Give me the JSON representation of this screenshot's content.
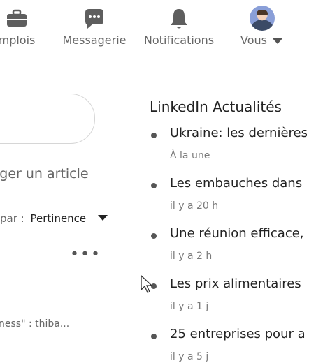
{
  "nav": {
    "jobs_label": "mplois",
    "messaging_label": "Messagerie",
    "notifications_label": "Notifications",
    "me_label": "Vous",
    "icons": {
      "jobs": "briefcase-icon",
      "messaging": "chat-bubble-icon",
      "notifications": "bell-icon",
      "me": "avatar"
    }
  },
  "left": {
    "write_article": "iger un article",
    "sort_prefix": "par :",
    "sort_value": "Pertinence",
    "more_label": "•••",
    "snippet": "ness\" : thiba..."
  },
  "news": {
    "title": "LinkedIn Actualités",
    "items": [
      {
        "headline": "Ukraine: les dernières",
        "meta": "À la une"
      },
      {
        "headline": "Les embauches dans",
        "meta": "il y a 20 h"
      },
      {
        "headline": "Une réunion efficace,",
        "meta": "il y a 2 h"
      },
      {
        "headline": "Les prix alimentaires",
        "meta": "il y a 1 j"
      },
      {
        "headline": "25 entreprises pour a",
        "meta": "il y a 5 j"
      }
    ]
  },
  "colors": {
    "icon": "#5e5e5e",
    "text_secondary": "#666666",
    "text_primary": "#222222"
  }
}
